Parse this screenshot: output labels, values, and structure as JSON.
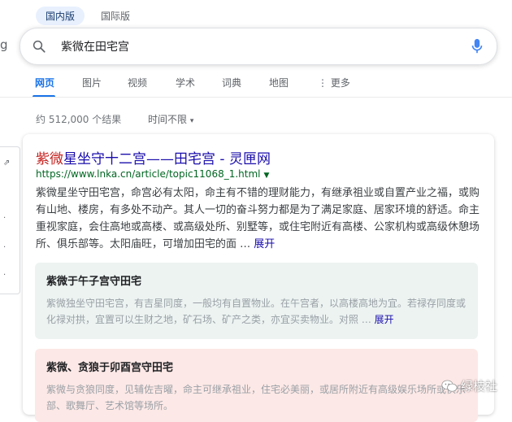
{
  "region_tabs": [
    "国内版",
    "国际版"
  ],
  "logo_fragment": "g",
  "search": {
    "value": "紫微在田宅宫"
  },
  "nav": {
    "items": [
      "网页",
      "图片",
      "视频",
      "学术",
      "词典",
      "地图",
      "更多"
    ],
    "more_icon": "more-vert-icon"
  },
  "stats": {
    "count": "约 512,000 个结果",
    "time_filter": "时间不限"
  },
  "left_panel": {
    "glyphs": [
      "⇗",
      "·",
      "·",
      "·"
    ]
  },
  "result": {
    "title_highlight": "紫微",
    "title_rest": "星坐守十二宫——田宅宫 - 灵匣网",
    "url": "https://www.lnka.cn/article/topic11068_1.html",
    "snippet": "紫微星坐守田宅宫，命宫必有太阳，命主有不错的理财能力，有继承祖业或自置产业之福，或购有山地、楼房，有多处不动产。其人一切的奋斗努力都是为了满足家庭、居家环境的舒适。命主重视家庭，会住高地或高楼、或高级处所、别墅等，或住宅附近有高楼、公家机构或高级休憩场所、俱乐部等。太阳庙旺，可增加田宅的面 …",
    "expand": "展开",
    "subcards": [
      {
        "title": "紫微于午子宫守田宅",
        "text": "紫微独坐守田宅宫，有吉星同度，一般均有自置物业。在午宫者，以高楼高地为宜。若禄存同度或化禄对拱，宜置可以生财之地，矿石场、矿产之类，亦宜买卖物业。对照 …",
        "expand": "展开"
      },
      {
        "title": "紫微、贪狼于卯酉宫守田宅",
        "text": "紫微与贪狼同度，见辅佐吉曜，命主可继承祖业，住宅必美丽，或居所附近有高级娱乐场所或俱乐部、歌舞厅、艺术馆等场所。"
      }
    ]
  },
  "watermark": "绿枝社",
  "colors": {
    "link": "#1a0dab",
    "highlight": "#c5221f",
    "url": "#006621",
    "accent": "#1a73e8"
  }
}
